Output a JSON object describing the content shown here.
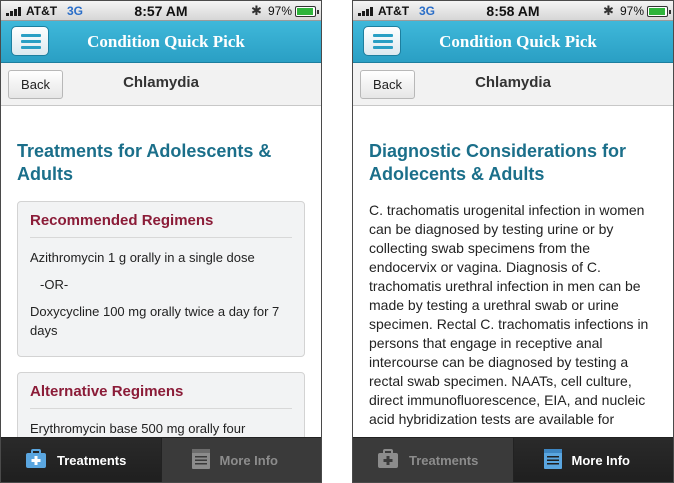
{
  "status_left": {
    "carrier": "AT&T",
    "network": "3G",
    "time": "8:57 AM",
    "battery": "97%",
    "battery_level": 0.97
  },
  "status_right": {
    "carrier": "AT&T",
    "network": "3G",
    "time": "8:58 AM",
    "battery": "97%",
    "battery_level": 0.97
  },
  "app": {
    "title": "Condition Quick Pick",
    "back_label": "Back",
    "condition": "Chlamydia"
  },
  "left": {
    "heading": "Treatments for Adolescents & Adults",
    "recommended": {
      "title": "Recommended Regimens",
      "line1": "Azithromycin 1 g orally in a single dose",
      "or": "-OR-",
      "line2": "Doxycycline 100 mg orally twice a day for 7 days"
    },
    "alternative": {
      "title": "Alternative Regimens",
      "line1": "Erythromycin base 500 mg orally four"
    }
  },
  "right": {
    "heading": "Diagnostic Considerations for Adolecents & Adults",
    "body": "C. trachomatis urogenital infection in women can be diagnosed by testing urine or by collecting swab specimens from the endocervix or vagina. Diagnosis of C. trachomatis urethral infection in men can be made by testing a urethral swab or urine specimen. Rectal C. trachomatis infections in persons that engage in receptive anal intercourse can be diagnosed by testing a rectal swab specimen. NAATs, cell culture, direct immunofluorescence, EIA, and nucleic acid hybridization tests are available for"
  },
  "tabs": {
    "treatments": "Treatments",
    "more_info": "More Info"
  },
  "icons": {
    "menu": "menu-icon",
    "treatments": "first-aid-kit-icon",
    "more_info": "notepad-icon",
    "bluetooth": "bluetooth-icon"
  },
  "colors": {
    "accent": "#2a9fc4",
    "heading": "#1b6f8a",
    "card_title": "#8b1c38"
  }
}
